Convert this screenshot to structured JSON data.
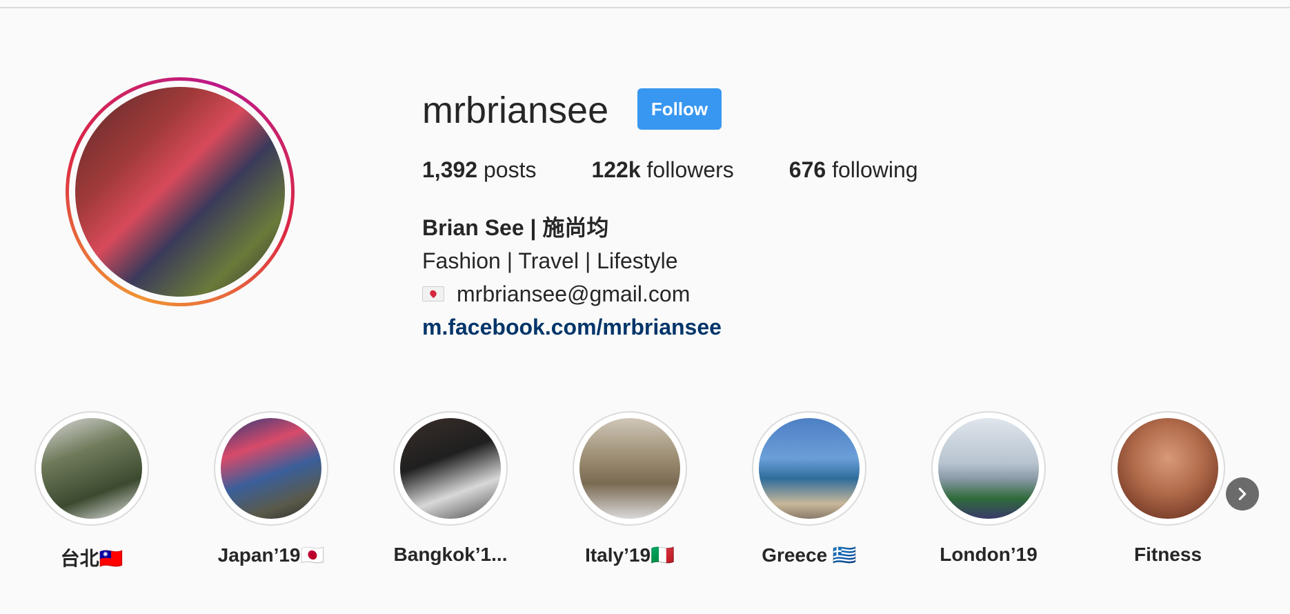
{
  "profile": {
    "username": "mrbriansee",
    "follow_label": "Follow",
    "stats": [
      {
        "count": "1,392",
        "label": "posts"
      },
      {
        "count": "122k",
        "label": "followers"
      },
      {
        "count": "676",
        "label": "following"
      }
    ],
    "full_name": "Brian See | 施尚均",
    "bio_line": "Fashion | Travel | Lifestyle",
    "email": "mrbriansee@gmail.com",
    "link": "m.facebook.com/mrbriansee"
  },
  "highlights": [
    {
      "label": "台北🇹🇼"
    },
    {
      "label": "Japan’19🇯🇵"
    },
    {
      "label": "Bangkok’1..."
    },
    {
      "label": "Italy’19🇮🇹"
    },
    {
      "label": "Greece 🇬🇷"
    },
    {
      "label": "London’19"
    },
    {
      "label": "Fitness"
    }
  ],
  "colors": {
    "follow_button": "#3897f0",
    "link": "#003569",
    "background": "#fafafa"
  },
  "icons": {
    "email": "love-letter-icon",
    "next": "chevron-right-icon"
  }
}
